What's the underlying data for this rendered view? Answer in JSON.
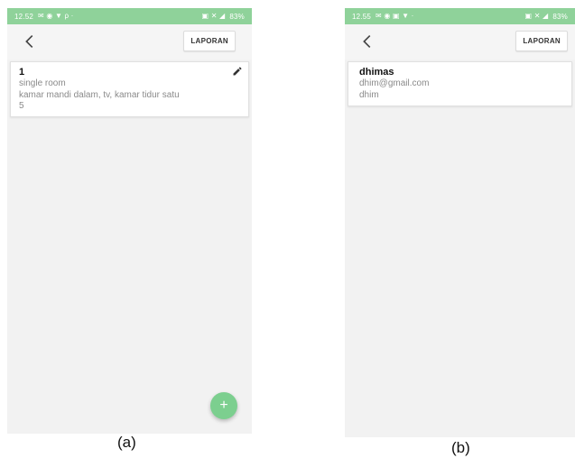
{
  "screens": {
    "a": {
      "status": {
        "time": "12.52",
        "left_icons": "✉ ◉ ▼ ρ ·",
        "right_icons": "▣ ✕ ◢",
        "battery": "83%"
      },
      "report_label": "LAPORAN",
      "card": {
        "title": "1",
        "line1": "single room",
        "line2": "kamar mandi dalam, tv, kamar tidur satu",
        "line3": "5"
      },
      "fab_label": "+",
      "caption": "(a)"
    },
    "b": {
      "status": {
        "time": "12.55",
        "left_icons": "✉ ◉ ▣ ▼ ·",
        "right_icons": "▣ ✕ ◢",
        "battery": "83%"
      },
      "report_label": "LAPORAN",
      "card": {
        "title": "dhimas",
        "line1": "dhim@gmail.com",
        "line2": "dhim"
      },
      "caption": "(b)"
    }
  },
  "colors": {
    "status_bar": "#8fd29a",
    "fab": "#7ccf8f",
    "screen_bg": "#f2f2f2"
  },
  "icons": {
    "back": "arrow-back-icon",
    "edit": "pencil-icon",
    "add": "plus-icon"
  }
}
